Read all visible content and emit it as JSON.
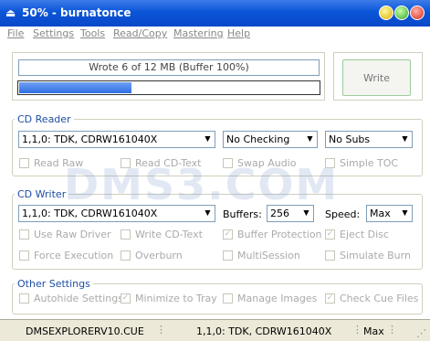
{
  "window": {
    "title": "50% - burnatonce"
  },
  "menu": [
    "File",
    "Settings",
    "Tools",
    "Read/Copy",
    "Mastering",
    "Help"
  ],
  "progress": {
    "status_text": "Wrote 6 of 12 MB (Buffer 100%)",
    "fraction": 0.5
  },
  "write_button": {
    "label": "Write"
  },
  "cd_reader": {
    "group_label": "CD Reader",
    "drive": "1,1,0: TDK, CDRW161040X",
    "checking": "No Checking",
    "subs": "No Subs",
    "options": [
      {
        "label": "Read Raw",
        "checked": false
      },
      {
        "label": "Read CD-Text",
        "checked": false
      },
      {
        "label": "Swap Audio",
        "checked": false
      },
      {
        "label": "Simple TOC",
        "checked": false
      }
    ]
  },
  "cd_writer": {
    "group_label": "CD Writer",
    "drive": "1,1,0: TDK, CDRW161040X",
    "buffers_label": "Buffers:",
    "buffers_value": "256",
    "speed_label": "Speed:",
    "speed_value": "Max",
    "options": [
      {
        "label": "Use Raw Driver",
        "checked": false
      },
      {
        "label": "Write CD-Text",
        "checked": false
      },
      {
        "label": "Buffer Protection",
        "checked": true
      },
      {
        "label": "Eject Disc",
        "checked": true
      },
      {
        "label": "Force Execution",
        "checked": false
      },
      {
        "label": "Overburn",
        "checked": false
      },
      {
        "label": "MultiSession",
        "checked": false
      },
      {
        "label": "Simulate Burn",
        "checked": false
      }
    ]
  },
  "other_settings": {
    "group_label": "Other Settings",
    "options": [
      {
        "label": "Autohide Settings",
        "checked": false
      },
      {
        "label": "Minimize to Tray",
        "checked": true
      },
      {
        "label": "Manage Images",
        "checked": false
      },
      {
        "label": "Check Cue Files",
        "checked": true
      }
    ]
  },
  "statusbar": {
    "file": "DMSEXPLORERV10.CUE",
    "drive": "1,1,0: TDK, CDRW161040X",
    "speed": "Max"
  },
  "watermark": "DMS3.COM"
}
